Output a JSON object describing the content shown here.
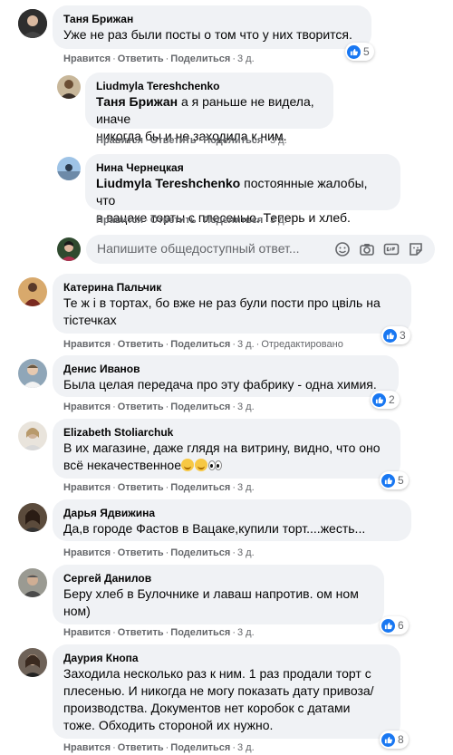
{
  "actions": {
    "like": "Нравится",
    "reply": "Ответить",
    "share": "Поделиться",
    "edited": "Отредактировано"
  },
  "composer": {
    "placeholder": "Напишите общедоступный ответ..."
  },
  "comments": [
    {
      "name": "Таня Брижан",
      "lines": [
        "Уже не раз были посты о том что у них творится."
      ],
      "time": "3 д.",
      "reactions": "5"
    },
    {
      "name": "Liudmyla Tereshchenko",
      "mention": "Таня Брижан",
      "lines": [
        " а я раньше не видела, иначе",
        "никогда бы и не заходила к ним."
      ],
      "time": "3 д."
    },
    {
      "name": "Нина Чернецкая",
      "mention": "Liudmyla Tereshchenko",
      "lines": [
        " постоянные жалобы, что",
        "в вацаке торты с плесенью. Теперь и хлеб."
      ],
      "time": "3 д."
    },
    {
      "name": "Катерина Пальчик",
      "lines": [
        "Те ж і в тортах, бо вже не раз були пости про цвіль на",
        "тістечках"
      ],
      "time": "3 д.",
      "reactions": "3"
    },
    {
      "name": "Денис Иванов",
      "lines": [
        "Была целая передача про эту фабрику - одна химия."
      ],
      "time": "3 д.",
      "reactions": "2"
    },
    {
      "name": "Elizabeth Stoliarchuk",
      "lines": [
        "В их магазине, даже глядя на витрину, видно, что оно",
        "всё некачественное"
      ],
      "time": "3 д.",
      "reactions": "5"
    },
    {
      "name": "Дарья Ядвижина",
      "lines": [
        "Да,в городе Фастов в Вацаке,купили торт....жесть..."
      ],
      "time": "3 д."
    },
    {
      "name": "Сергей Данилов",
      "lines": [
        "Беру хлеб в Булочнике и лаваш напротив. ом ном",
        "ном)"
      ],
      "time": "3 д.",
      "reactions": "6"
    },
    {
      "name": "Даурия Кнопа",
      "lines": [
        "Заходила несколько раз к ним. 1 раз продали торт с",
        "плесенью. И никогда не могу показать дату привоза/",
        "производства. Документов нет коробок с датами",
        "тоже. Обходить стороной их нужно."
      ],
      "time": "3 д.",
      "reactions": "8"
    }
  ],
  "colors": {
    "bubble": "#f0f2f5",
    "like_blue": "#1877f2",
    "meta_gray": "#65676b"
  }
}
